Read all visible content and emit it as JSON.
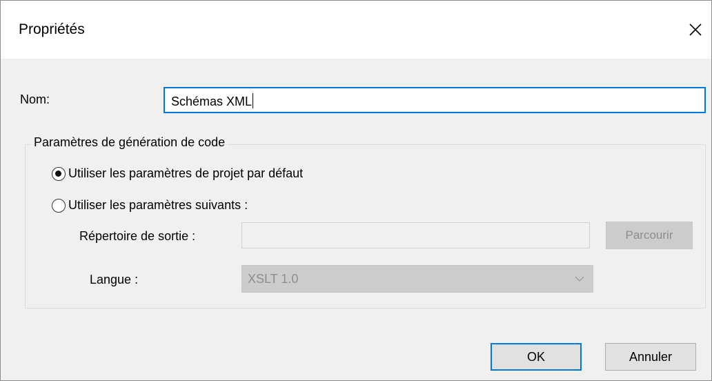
{
  "window": {
    "title": "Propriétés"
  },
  "name": {
    "label": "Nom:",
    "value": "Schémas XML"
  },
  "codegen": {
    "group_label": "Paramètres de génération de code",
    "option_default": {
      "label": "Utiliser les paramètres de projet par défaut",
      "checked": true
    },
    "option_custom": {
      "label": "Utiliser les paramètres suivants :",
      "checked": false
    },
    "output_dir": {
      "label": "Répertoire de sortie :",
      "value": "",
      "browse_label": "Parcourir"
    },
    "language": {
      "label": "Langue :",
      "selected": "XSLT 1.0"
    }
  },
  "footer": {
    "ok_label": "OK",
    "cancel_label": "Annuler"
  },
  "colors": {
    "accent": "#0078d7",
    "dialog_bg": "#f0f0f0",
    "disabled_text": "#8d8d8d"
  }
}
